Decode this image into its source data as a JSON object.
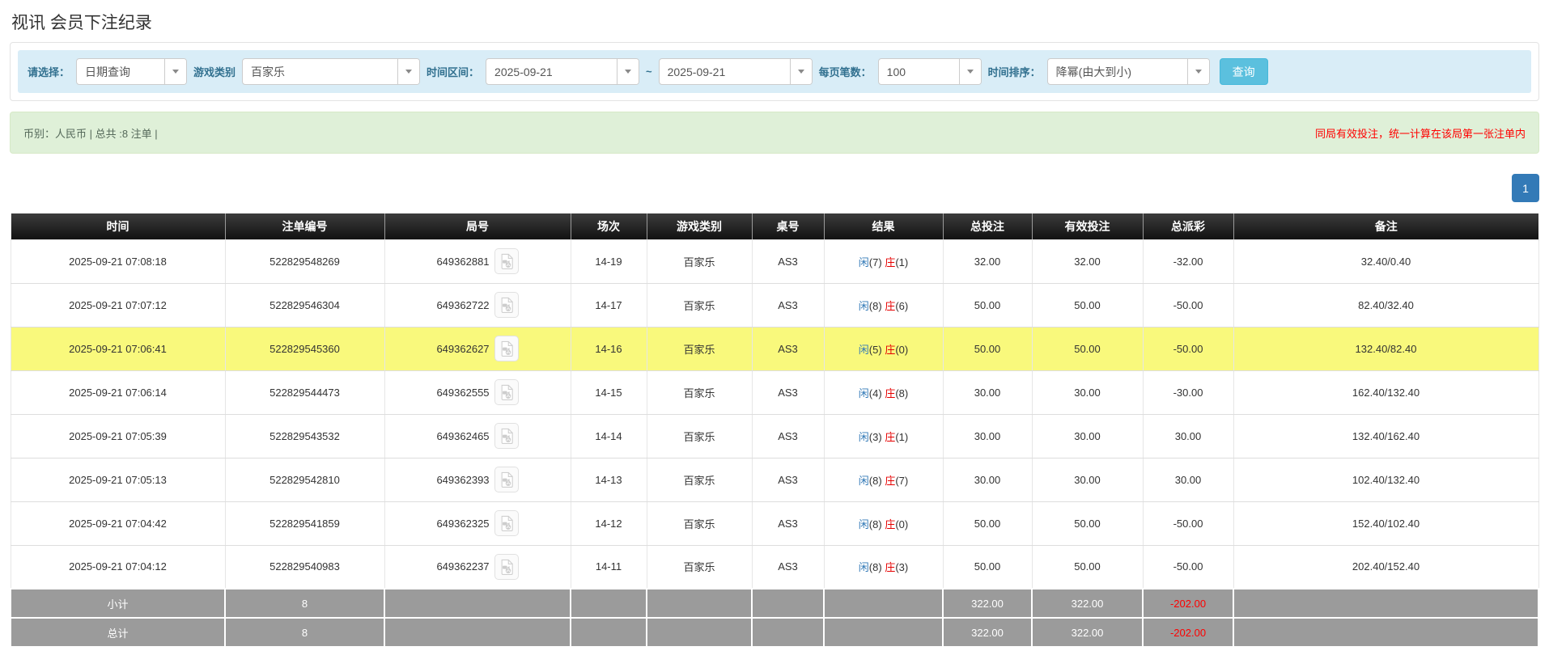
{
  "page": {
    "title": "视讯 会员下注纪录"
  },
  "filters": {
    "select_label": "请选择：",
    "select_value": "日期查询",
    "game_type_label": "游戏类别",
    "game_type_value": "百家乐",
    "date_range_label": "时间区间：",
    "date_from": "2025-09-21",
    "tilde": "~",
    "date_to": "2025-09-21",
    "page_size_label": "每页笔数：",
    "page_size_value": "100",
    "sort_label": "时间排序：",
    "sort_value": "降幂(由大到小)",
    "search_button": "查询"
  },
  "summary": {
    "left_text": "币别：人民币 | 总共 :8 注单 |",
    "right_note": "同局有效投注，统一计算在该局第一张注单内"
  },
  "pagination": {
    "current_page": "1"
  },
  "table": {
    "headers": [
      "时间",
      "注单编号",
      "局号",
      "场次",
      "游戏类别",
      "桌号",
      "结果",
      "总投注",
      "有效投注",
      "总派彩",
      "备注"
    ],
    "rows": [
      {
        "time": "2025-09-21 07:08:18",
        "bet_id": "522829548269",
        "round_id": "649362881",
        "session": "14-19",
        "game": "百家乐",
        "table_no": "AS3",
        "result_player": "闲",
        "result_player_score": "(7)",
        "result_banker": "庄",
        "result_banker_score": "(1)",
        "total_bet": "32.00",
        "valid_bet": "32.00",
        "payout": "-32.00",
        "remark": "32.40/0.40",
        "highlighted": false
      },
      {
        "time": "2025-09-21 07:07:12",
        "bet_id": "522829546304",
        "round_id": "649362722",
        "session": "14-17",
        "game": "百家乐",
        "table_no": "AS3",
        "result_player": "闲",
        "result_player_score": "(8)",
        "result_banker": "庄",
        "result_banker_score": "(6)",
        "total_bet": "50.00",
        "valid_bet": "50.00",
        "payout": "-50.00",
        "remark": "82.40/32.40",
        "highlighted": false
      },
      {
        "time": "2025-09-21 07:06:41",
        "bet_id": "522829545360",
        "round_id": "649362627",
        "session": "14-16",
        "game": "百家乐",
        "table_no": "AS3",
        "result_player": "闲",
        "result_player_score": "(5)",
        "result_banker": "庄",
        "result_banker_score": "(0)",
        "total_bet": "50.00",
        "valid_bet": "50.00",
        "payout": "-50.00",
        "remark": "132.40/82.40",
        "highlighted": true
      },
      {
        "time": "2025-09-21 07:06:14",
        "bet_id": "522829544473",
        "round_id": "649362555",
        "session": "14-15",
        "game": "百家乐",
        "table_no": "AS3",
        "result_player": "闲",
        "result_player_score": "(4)",
        "result_banker": "庄",
        "result_banker_score": "(8)",
        "total_bet": "30.00",
        "valid_bet": "30.00",
        "payout": "-30.00",
        "remark": "162.40/132.40",
        "highlighted": false
      },
      {
        "time": "2025-09-21 07:05:39",
        "bet_id": "522829543532",
        "round_id": "649362465",
        "session": "14-14",
        "game": "百家乐",
        "table_no": "AS3",
        "result_player": "闲",
        "result_player_score": "(3)",
        "result_banker": "庄",
        "result_banker_score": "(1)",
        "total_bet": "30.00",
        "valid_bet": "30.00",
        "payout": "30.00",
        "remark": "132.40/162.40",
        "highlighted": false
      },
      {
        "time": "2025-09-21 07:05:13",
        "bet_id": "522829542810",
        "round_id": "649362393",
        "session": "14-13",
        "game": "百家乐",
        "table_no": "AS3",
        "result_player": "闲",
        "result_player_score": "(8)",
        "result_banker": "庄",
        "result_banker_score": "(7)",
        "total_bet": "30.00",
        "valid_bet": "30.00",
        "payout": "30.00",
        "remark": "102.40/132.40",
        "highlighted": false
      },
      {
        "time": "2025-09-21 07:04:42",
        "bet_id": "522829541859",
        "round_id": "649362325",
        "session": "14-12",
        "game": "百家乐",
        "table_no": "AS3",
        "result_player": "闲",
        "result_player_score": "(8)",
        "result_banker": "庄",
        "result_banker_score": "(0)",
        "total_bet": "50.00",
        "valid_bet": "50.00",
        "payout": "-50.00",
        "remark": "152.40/102.40",
        "highlighted": false
      },
      {
        "time": "2025-09-21 07:04:12",
        "bet_id": "522829540983",
        "round_id": "649362237",
        "session": "14-11",
        "game": "百家乐",
        "table_no": "AS3",
        "result_player": "闲",
        "result_player_score": "(8)",
        "result_banker": "庄",
        "result_banker_score": "(3)",
        "total_bet": "50.00",
        "valid_bet": "50.00",
        "payout": "-50.00",
        "remark": "202.40/152.40",
        "highlighted": false
      }
    ],
    "footer": [
      {
        "label": "小计",
        "count": "8",
        "total_bet": "322.00",
        "valid_bet": "322.00",
        "payout": "-202.00"
      },
      {
        "label": "总计",
        "count": "8",
        "total_bet": "322.00",
        "valid_bet": "322.00",
        "payout": "-202.00"
      }
    ]
  },
  "colors": {
    "filter_bar_bg": "#d9edf7",
    "filter_label": "#31708f",
    "search_button_bg": "#5bc0de",
    "summary_bg": "#dff0d8",
    "summary_note_red": "#ff0000",
    "pagination_blue": "#337ab7",
    "header_bg": "#1a1a1a",
    "highlight_yellow": "#f9f97c",
    "footer_gray": "#9b9b9b",
    "link_blue": "#2a7fdc",
    "player_blue": "#337ab7",
    "banker_red": "#e60000"
  }
}
